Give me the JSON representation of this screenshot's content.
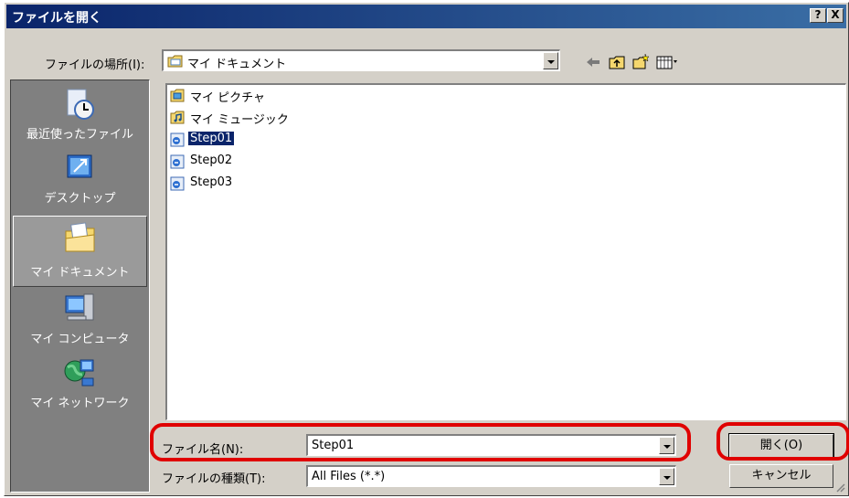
{
  "dialog": {
    "title": "ファイルを開く",
    "help_label": "?",
    "close_label": "X"
  },
  "location": {
    "label": "ファイルの場所(I):",
    "value": "マイ ドキュメント",
    "icon": "folder-icon"
  },
  "toolbar": {
    "icons": [
      "back-icon",
      "up-folder-icon",
      "new-folder-icon",
      "view-menu-icon"
    ]
  },
  "places": [
    {
      "label": "最近使ったファイル",
      "icon": "recent-icon"
    },
    {
      "label": "デスクトップ",
      "icon": "desktop-icon"
    },
    {
      "label": "マイ ドキュメント",
      "icon": "my-documents-icon",
      "selected": true
    },
    {
      "label": "マイ コンピュータ",
      "icon": "my-computer-icon"
    },
    {
      "label": "マイ ネットワーク",
      "icon": "network-icon"
    }
  ],
  "files": [
    {
      "name": "マイ ピクチャ",
      "icon": "pictures-folder-icon"
    },
    {
      "name": "マイ ミュージック",
      "icon": "music-folder-icon"
    },
    {
      "name": "Step01",
      "icon": "project-file-icon",
      "selected": true
    },
    {
      "name": "Step02",
      "icon": "project-file-icon"
    },
    {
      "name": "Step03",
      "icon": "project-file-icon"
    }
  ],
  "filename": {
    "label": "ファイル名(N):",
    "value": "Step01"
  },
  "filetype": {
    "label": "ファイルの種類(T):",
    "value": "All Files (*.*)"
  },
  "buttons": {
    "open": "開く(O)",
    "cancel": "キャンセル"
  },
  "colors": {
    "title_bar": "#0a246a",
    "highlight_ring": "#e00000",
    "selection": "#0a246a",
    "face": "#d4d0c8"
  }
}
